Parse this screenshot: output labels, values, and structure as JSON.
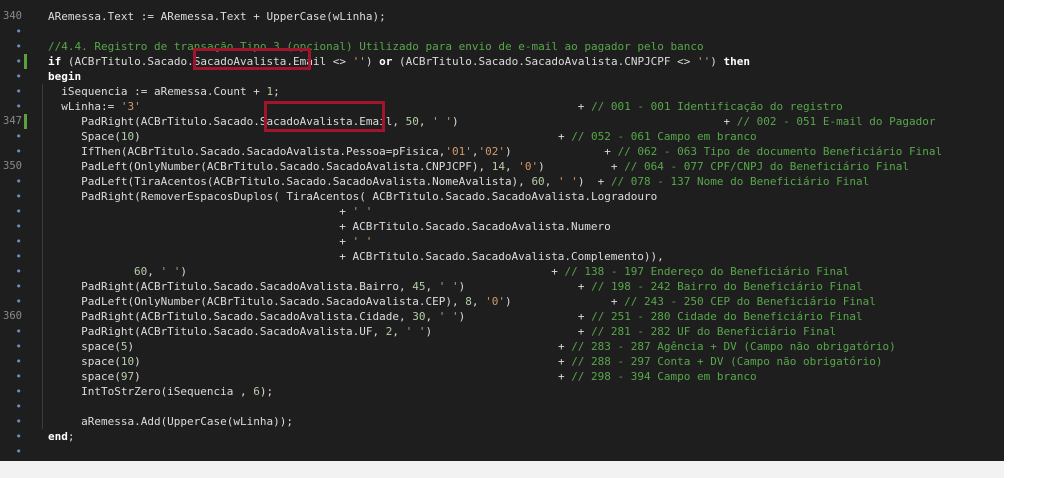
{
  "gutter_numbers": [
    {
      "row": 0,
      "text": "340"
    },
    {
      "row": 7,
      "text": "347"
    },
    {
      "row": 10,
      "text": "350"
    },
    {
      "row": 20,
      "text": "360"
    }
  ],
  "lines": [
    {
      "indent": 0,
      "tokens": [
        {
          "t": "ARemessa.Text := ARemessa.Text + UpperCase(wLinha);",
          "c": ""
        }
      ]
    },
    {
      "indent": 0,
      "tokens": []
    },
    {
      "indent": 0,
      "tokens": [
        {
          "t": "//4.4. Registro de transação Tipo 3 (opcional) Utilizado para envio de e-mail ao pagador pelo banco",
          "c": "c"
        }
      ]
    },
    {
      "indent": 0,
      "tokens": [
        {
          "t": "if",
          "c": "k"
        },
        {
          "t": " (ACBrTitulo.Sacado.SacadoAvalista.Email <> ",
          "c": ""
        },
        {
          "t": "''",
          "c": "s"
        },
        {
          "t": ") ",
          "c": ""
        },
        {
          "t": "or",
          "c": "k"
        },
        {
          "t": " (ACBrTitulo.Sacado.SacadoAvalista.CNPJCPF <> ",
          "c": ""
        },
        {
          "t": "''",
          "c": "s"
        },
        {
          "t": ") ",
          "c": ""
        },
        {
          "t": "then",
          "c": "k"
        }
      ]
    },
    {
      "indent": 0,
      "tokens": [
        {
          "t": "begin",
          "c": "k"
        }
      ]
    },
    {
      "indent": 2,
      "tokens": [
        {
          "t": "iSequencia := aRemessa.Count + ",
          "c": ""
        },
        {
          "t": "1",
          "c": "n"
        },
        {
          "t": ";",
          "c": ""
        }
      ]
    },
    {
      "indent": 2,
      "tokens": [
        {
          "t": "wLinha:= ",
          "c": ""
        },
        {
          "t": "'3'",
          "c": "s"
        },
        {
          "t": "                                                                  + ",
          "c": ""
        },
        {
          "t": "// 001 - 001 Identificação do registro",
          "c": "c"
        }
      ]
    },
    {
      "indent": 5,
      "tokens": [
        {
          "t": "PadRight(ACBrTitulo.Sacado.SacadoAvalista.Email, ",
          "c": ""
        },
        {
          "t": "50",
          "c": "n"
        },
        {
          "t": ", ",
          "c": ""
        },
        {
          "t": "' '",
          "c": "s"
        },
        {
          "t": ")",
          "c": ""
        },
        {
          "t": "                                        + ",
          "c": ""
        },
        {
          "t": "// 002 - 051 E-mail do Pagador",
          "c": "c"
        }
      ]
    },
    {
      "indent": 5,
      "tokens": [
        {
          "t": "Space(",
          "c": ""
        },
        {
          "t": "10",
          "c": "n"
        },
        {
          "t": ")",
          "c": ""
        },
        {
          "t": "                                                               + ",
          "c": ""
        },
        {
          "t": "// 052 - 061 Campo em branco",
          "c": "c"
        }
      ]
    },
    {
      "indent": 5,
      "tokens": [
        {
          "t": "IfThen(ACBrTitulo.Sacado.SacadoAvalista.Pessoa=pFisica,",
          "c": ""
        },
        {
          "t": "'01'",
          "c": "s"
        },
        {
          "t": ",",
          "c": ""
        },
        {
          "t": "'02'",
          "c": "s"
        },
        {
          "t": ")",
          "c": ""
        },
        {
          "t": "              + ",
          "c": ""
        },
        {
          "t": "// 062 - 063 Tipo de documento Beneficiário Final",
          "c": "c"
        }
      ]
    },
    {
      "indent": 5,
      "tokens": [
        {
          "t": "PadLeft(OnlyNumber(ACBrTitulo.Sacado.SacadoAvalista.CNPJCPF), ",
          "c": ""
        },
        {
          "t": "14",
          "c": "n"
        },
        {
          "t": ", ",
          "c": ""
        },
        {
          "t": "'0'",
          "c": "s"
        },
        {
          "t": ")",
          "c": ""
        },
        {
          "t": "          + ",
          "c": ""
        },
        {
          "t": "// 064 - 077 CPF/CNPJ do Beneficiário Final",
          "c": "c"
        }
      ]
    },
    {
      "indent": 5,
      "tokens": [
        {
          "t": "PadLeft(TiraAcentos(ACBrTitulo.Sacado.SacadoAvalista.NomeAvalista), ",
          "c": ""
        },
        {
          "t": "60",
          "c": "n"
        },
        {
          "t": ", ",
          "c": ""
        },
        {
          "t": "' '",
          "c": "s"
        },
        {
          "t": ")",
          "c": ""
        },
        {
          "t": "  + ",
          "c": ""
        },
        {
          "t": "// 078 - 137 Nome do Beneficiário Final",
          "c": "c"
        }
      ]
    },
    {
      "indent": 5,
      "tokens": [
        {
          "t": "PadRight(RemoverEspacosDuplos( TiraAcentos( ACBrTitulo.Sacado.SacadoAvalista.Logradouro",
          "c": ""
        }
      ]
    },
    {
      "indent": 44,
      "tokens": [
        {
          "t": "+ ",
          "c": ""
        },
        {
          "t": "' '",
          "c": "s"
        }
      ]
    },
    {
      "indent": 44,
      "tokens": [
        {
          "t": "+ ACBrTitulo.Sacado.SacadoAvalista.Numero",
          "c": ""
        }
      ]
    },
    {
      "indent": 44,
      "tokens": [
        {
          "t": "+ ",
          "c": ""
        },
        {
          "t": "' '",
          "c": "s"
        }
      ]
    },
    {
      "indent": 44,
      "tokens": [
        {
          "t": "+ ACBrTitulo.Sacado.SacadoAvalista.Complemento)),",
          "c": ""
        }
      ]
    },
    {
      "indent": 13,
      "tokens": [
        {
          "t": "60",
          "c": "n"
        },
        {
          "t": ", ",
          "c": ""
        },
        {
          "t": "' '",
          "c": "s"
        },
        {
          "t": ")",
          "c": ""
        },
        {
          "t": "                                                       + ",
          "c": ""
        },
        {
          "t": "// 138 - 197 Endereço do Beneficiário Final",
          "c": "c"
        }
      ]
    },
    {
      "indent": 5,
      "tokens": [
        {
          "t": "PadRight(ACBrTitulo.Sacado.SacadoAvalista.Bairro, ",
          "c": ""
        },
        {
          "t": "45",
          "c": "n"
        },
        {
          "t": ", ",
          "c": ""
        },
        {
          "t": "' '",
          "c": "s"
        },
        {
          "t": ")",
          "c": ""
        },
        {
          "t": "                 + ",
          "c": ""
        },
        {
          "t": "// 198 - 242 Bairro do Beneficiário Final",
          "c": "c"
        }
      ]
    },
    {
      "indent": 5,
      "tokens": [
        {
          "t": "PadLeft(OnlyNumber(ACBrTitulo.Sacado.SacadoAvalista.CEP), ",
          "c": ""
        },
        {
          "t": "8",
          "c": "n"
        },
        {
          "t": ", ",
          "c": ""
        },
        {
          "t": "'0'",
          "c": "s"
        },
        {
          "t": ")",
          "c": ""
        },
        {
          "t": "               + ",
          "c": ""
        },
        {
          "t": "// 243 - 250 CEP do Beneficiário Final",
          "c": "c"
        }
      ]
    },
    {
      "indent": 5,
      "tokens": [
        {
          "t": "PadRight(ACBrTitulo.Sacado.SacadoAvalista.Cidade, ",
          "c": ""
        },
        {
          "t": "30",
          "c": "n"
        },
        {
          "t": ", ",
          "c": ""
        },
        {
          "t": "' '",
          "c": "s"
        },
        {
          "t": ")",
          "c": ""
        },
        {
          "t": "                 + ",
          "c": ""
        },
        {
          "t": "// 251 - 280 Cidade do Beneficiário Final",
          "c": "c"
        }
      ]
    },
    {
      "indent": 5,
      "tokens": [
        {
          "t": "PadRight(ACBrTitulo.Sacado.SacadoAvalista.UF, ",
          "c": ""
        },
        {
          "t": "2",
          "c": "n"
        },
        {
          "t": ", ",
          "c": ""
        },
        {
          "t": "' '",
          "c": "s"
        },
        {
          "t": ")",
          "c": ""
        },
        {
          "t": "                      + ",
          "c": ""
        },
        {
          "t": "// 281 - 282 UF do Beneficiário Final",
          "c": "c"
        }
      ]
    },
    {
      "indent": 5,
      "tokens": [
        {
          "t": "space(",
          "c": ""
        },
        {
          "t": "5",
          "c": "n"
        },
        {
          "t": ")",
          "c": ""
        },
        {
          "t": "                                                                + ",
          "c": ""
        },
        {
          "t": "// 283 - 287 Agência + DV (Campo não obrigatório)",
          "c": "c"
        }
      ]
    },
    {
      "indent": 5,
      "tokens": [
        {
          "t": "space(",
          "c": ""
        },
        {
          "t": "10",
          "c": "n"
        },
        {
          "t": ")",
          "c": ""
        },
        {
          "t": "                                                               + ",
          "c": ""
        },
        {
          "t": "// 288 - 297 Conta + DV (Campo não obrigatório)",
          "c": "c"
        }
      ]
    },
    {
      "indent": 5,
      "tokens": [
        {
          "t": "space(",
          "c": ""
        },
        {
          "t": "97",
          "c": "n"
        },
        {
          "t": ")",
          "c": ""
        },
        {
          "t": "                                                               + ",
          "c": ""
        },
        {
          "t": "// 298 - 394 Campo em branco",
          "c": "c"
        }
      ]
    },
    {
      "indent": 5,
      "tokens": [
        {
          "t": "IntToStrZero(iSequencia , ",
          "c": ""
        },
        {
          "t": "6",
          "c": "n"
        },
        {
          "t": ");",
          "c": ""
        }
      ]
    },
    {
      "indent": 0,
      "tokens": []
    },
    {
      "indent": 5,
      "tokens": [
        {
          "t": "aRemessa.Add(UpperCase(wLinha));",
          "c": ""
        }
      ]
    },
    {
      "indent": 0,
      "tokens": [
        {
          "t": "end",
          "c": "k"
        },
        {
          "t": ";",
          "c": ""
        }
      ]
    },
    {
      "indent": 0,
      "tokens": []
    }
  ],
  "highlight_color": "#a0152b"
}
